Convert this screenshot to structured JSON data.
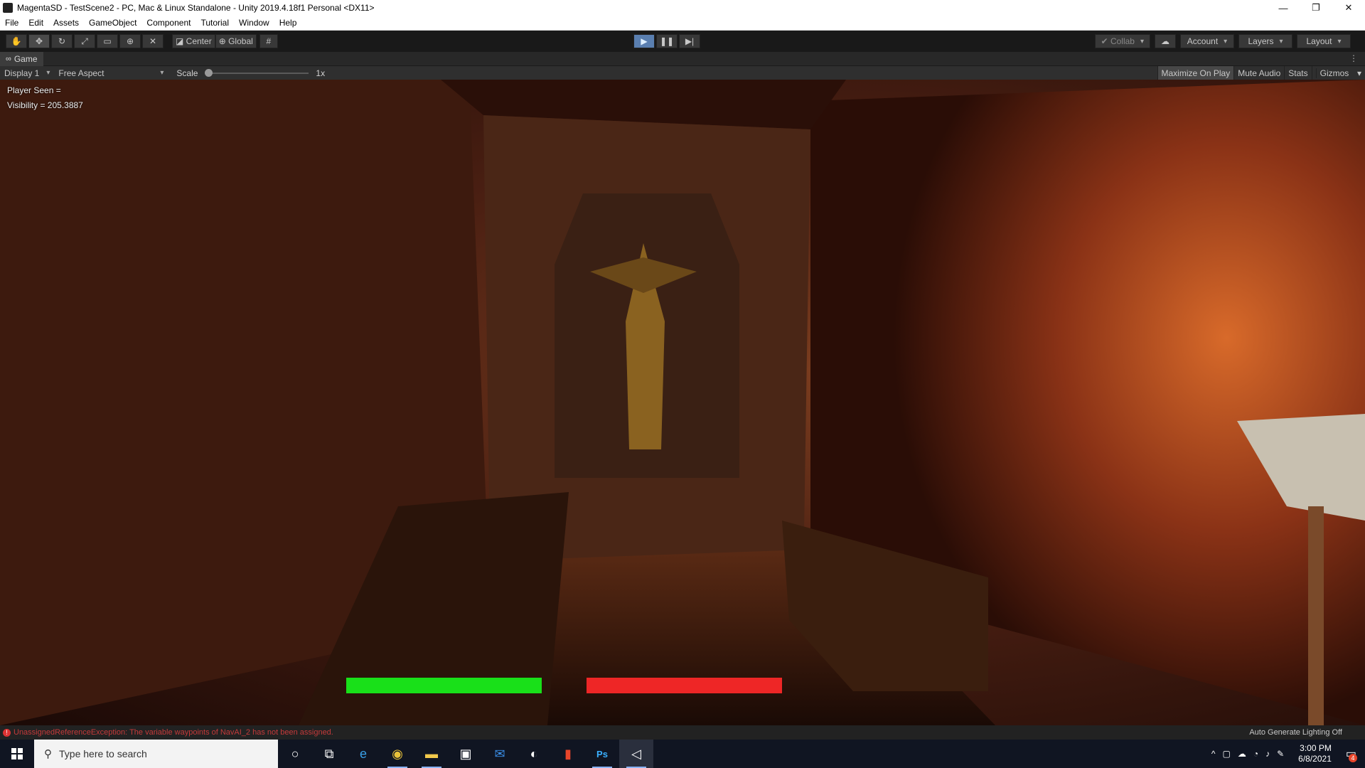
{
  "window": {
    "title": "MagentaSD - TestScene2 - PC, Mac & Linux Standalone - Unity 2019.4.18f1 Personal <DX11>",
    "minimize": "—",
    "restore": "❐",
    "close": "✕"
  },
  "menu": [
    "File",
    "Edit",
    "Assets",
    "GameObject",
    "Component",
    "Tutorial",
    "Window",
    "Help"
  ],
  "toolbar": {
    "tools": [
      {
        "name": "hand-tool",
        "glyph": "✋"
      },
      {
        "name": "move-tool",
        "glyph": "✥"
      },
      {
        "name": "rotate-tool",
        "glyph": "↻"
      },
      {
        "name": "scale-tool",
        "glyph": "⤢"
      },
      {
        "name": "rect-tool",
        "glyph": "▭"
      },
      {
        "name": "transform-tool",
        "glyph": "⊕"
      },
      {
        "name": "custom-tool",
        "glyph": "✕"
      }
    ],
    "pivot": "Center",
    "space": "Global",
    "snap": "#",
    "play": "▶",
    "pause": "❚❚",
    "step": "▶|",
    "collab": "Collab",
    "cloud": "☁",
    "account": "Account",
    "layers": "Layers",
    "layout": "Layout"
  },
  "tab": {
    "label": "Game",
    "icon": "∞",
    "menu": "⋮"
  },
  "game_bar": {
    "display": "Display 1",
    "aspect": "Free Aspect",
    "scale_label": "Scale",
    "scale_value": "1x",
    "maximize": "Maximize On Play",
    "mute": "Mute Audio",
    "stats": "Stats",
    "gizmos": "Gizmos"
  },
  "hud": {
    "player_seen": "Player Seen =",
    "visibility": "Visibility = 205.3887"
  },
  "bars": {
    "green_color": "#19e019",
    "red_color": "#ee2626",
    "green_fill": 1.0,
    "red_fill": 1.0
  },
  "status": {
    "error": "UnassignedReferenceException: The variable waypoints of NavAI_2 has not been assigned.",
    "lighting": "Auto Generate Lighting Off"
  },
  "taskbar": {
    "search_placeholder": "Type here to search",
    "time": "3:00 PM",
    "date": "6/8/2021",
    "notifications": "4",
    "apps": [
      "cortana-icon",
      "task-view-icon",
      "edge-icon",
      "chrome-icon",
      "file-explorer-icon",
      "store-icon",
      "mail-icon",
      "alienware-icon",
      "office-icon",
      "photoshop-icon",
      "unity-icon"
    ]
  }
}
